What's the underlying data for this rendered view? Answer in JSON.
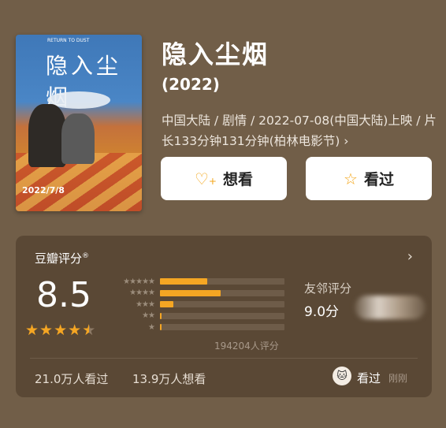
{
  "poster": {
    "title": "隐入尘烟",
    "english_title": "RETURN TO DUST",
    "date": "2022/7/8"
  },
  "movie": {
    "title": "隐入尘烟",
    "year": "(2022)",
    "info": "中国大陆 / 剧情 / 2022-07-08(中国大陆)上映 / 片长133分钟131分钟(柏林电影节) ›"
  },
  "buttons": {
    "want": {
      "label": "想看",
      "icon": "heart-plus-icon"
    },
    "seen": {
      "label": "看过",
      "icon": "star-outline-icon"
    }
  },
  "rating": {
    "label": "豆瓣评分",
    "registered": "®",
    "score": "8.5",
    "stars_value": 4.5,
    "distribution": [
      {
        "stars": "★★★★★",
        "percent": 0.38
      },
      {
        "stars": "★★★★",
        "percent": 0.49
      },
      {
        "stars": "★★★",
        "percent": 0.11
      },
      {
        "stars": "★★",
        "percent": 0.01
      },
      {
        "stars": "★",
        "percent": 0.005
      }
    ],
    "count_text": "194204人评分",
    "friends_label": "友邻评分",
    "friends_score": "9.0分"
  },
  "stats": {
    "seen": "21.0万人看过",
    "want": "13.9万人想看",
    "my_status": "看过",
    "my_time": "刚刚"
  },
  "colors": {
    "accent": "#f5a623",
    "background": "#715e48",
    "card": "#5a4835"
  }
}
